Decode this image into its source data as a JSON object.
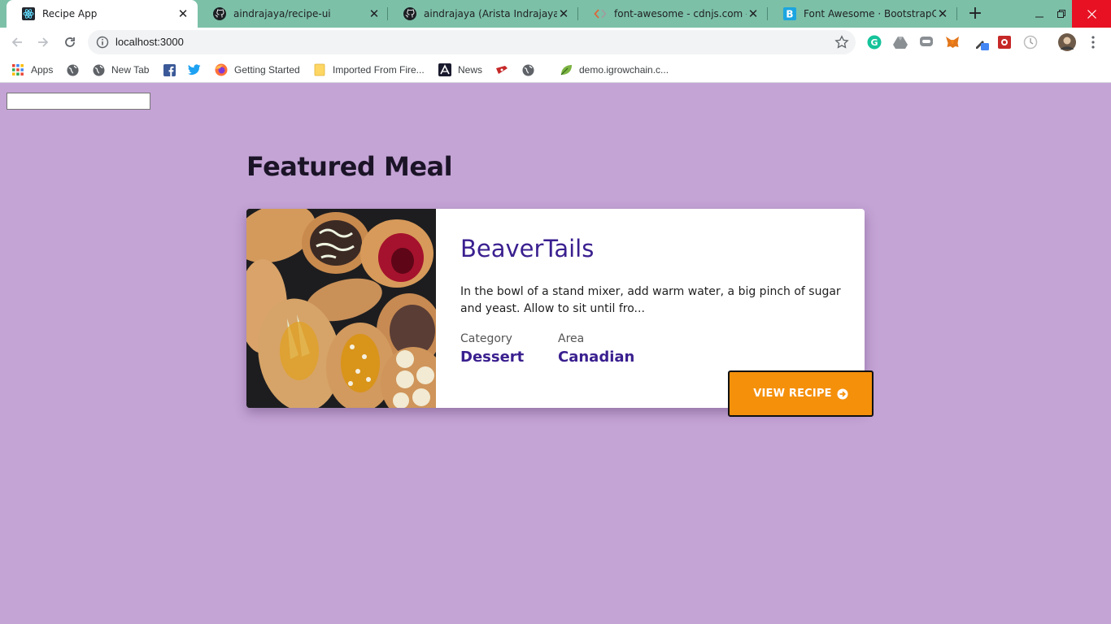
{
  "browser": {
    "tabs": [
      {
        "title": "Recipe App",
        "icon": "react-icon",
        "active": true
      },
      {
        "title": "aindrajaya/recipe-ui",
        "icon": "github-icon",
        "active": false
      },
      {
        "title": "aindrajaya (Arista Indrajaya)",
        "icon": "github-icon",
        "active": false
      },
      {
        "title": "font-awesome - cdnjs.com - The",
        "icon": "code-icon",
        "active": false
      },
      {
        "title": "Font Awesome · BootstrapCDN",
        "icon": "bootstrap-icon",
        "active": false
      }
    ],
    "new_tab": "+",
    "url": "localhost:3000",
    "bookmarks": [
      {
        "label": "Apps",
        "icon": "apps-grid-icon"
      },
      {
        "label": "",
        "icon": "globe-icon"
      },
      {
        "label": "New Tab",
        "icon": "globe-icon"
      },
      {
        "label": "",
        "icon": "facebook-icon"
      },
      {
        "label": "",
        "icon": "twitter-icon"
      },
      {
        "label": "Getting Started",
        "icon": "firefox-icon"
      },
      {
        "label": "Imported From Fire...",
        "icon": "folder-icon"
      },
      {
        "label": "News",
        "icon": "news-icon"
      },
      {
        "label": "",
        "icon": "ticket-icon"
      },
      {
        "label": "",
        "icon": "globe-icon"
      },
      {
        "label": "demo.igrowchain.c...",
        "icon": "leaf-icon"
      }
    ],
    "colors": {
      "tabstrip": "#7cc0a8",
      "page_bg": "#c4a3d5"
    }
  },
  "page": {
    "search": {
      "value": "",
      "placeholder": ""
    },
    "section_title": "Featured Meal",
    "meal": {
      "name": "BeaverTails",
      "description": "In the bowl of a stand mixer, add warm water, a big pinch of sugar and yeast. Allow to sit until fro...",
      "category_label": "Category",
      "category": "Dessert",
      "area_label": "Area",
      "area": "Canadian",
      "button_label": "VIEW RECIPE",
      "button_icon": "arrow-circle-right-icon"
    },
    "colors": {
      "accent": "#3a1f8f",
      "button": "#f5900b"
    }
  }
}
